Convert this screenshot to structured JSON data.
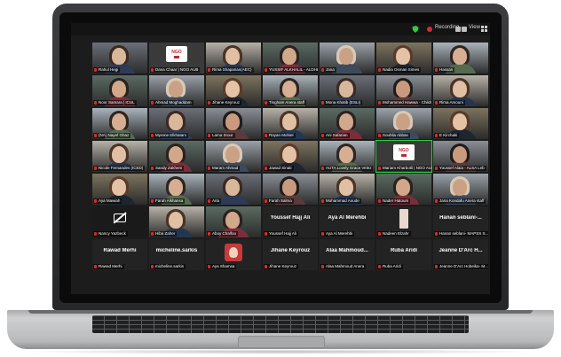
{
  "topbar": {
    "recording_label": "Recording...",
    "view_label": "View"
  },
  "rows": [
    [
      {
        "name": "Rahul Hegi"
      },
      {
        "name": "Dana Chaar | NGO AUB",
        "logo": true
      },
      {
        "name": "Rima Shaparian(AEC)"
      },
      {
        "name": "YUSSIF ALKHALIL - ALDHL"
      },
      {
        "name": "Jana"
      },
      {
        "name": "Nadia Osman Simes"
      },
      {
        "name": "Hassan"
      }
    ],
    [
      {
        "name": "Noor Samara | ICUL"
      },
      {
        "name": "Ahmad Moghaddam"
      },
      {
        "name": "Jihane Keyrouz"
      },
      {
        "name": "Tingham Anera staff"
      },
      {
        "name": "Mona Khatib (ESLI)"
      },
      {
        "name": "Mohammed Hawwa - Childs"
      },
      {
        "name": "Rima Amouni"
      }
    ],
    [
      {
        "name": "(NA) Nayef Ghaz"
      },
      {
        "name": "Myrene Elkhatani"
      },
      {
        "name": "Lama Srour"
      },
      {
        "name": "Rayan Mohiel"
      },
      {
        "name": "Ani Safarian"
      },
      {
        "name": "Souhila Abbas"
      },
      {
        "name": "E Kirchaki"
      }
    ],
    [
      {
        "name": "Nicole Fernandes (ICED)"
      },
      {
        "name": "Sandy Zakhem"
      },
      {
        "name": "Maram Ahmad"
      },
      {
        "name": "Jawad Sinati"
      },
      {
        "name": "AUTA Lovely Grace Velez"
      },
      {
        "name": "Mariam Kharbotli | NGO AUB",
        "logo": true,
        "active": true
      },
      {
        "name": "Youssef Alaia - ALSA Leb"
      }
    ],
    [
      {
        "name": "Aya Mawiah"
      },
      {
        "name": "Farah Alkhansa"
      },
      {
        "name": "Aria"
      },
      {
        "name": "Farah Salma"
      },
      {
        "name": "Mohammad Aoude"
      },
      {
        "name": "Nader Hatoum"
      },
      {
        "name": "Jana Kondafu Anera staff"
      }
    ],
    [
      {
        "name": "Nancy Yazbeck",
        "camoff": true
      },
      {
        "name": "Hiba Zaher"
      },
      {
        "name": "Aboy Chalfoo"
      },
      {
        "name": "Youssef Hajj Ali",
        "big": "Youssef Hajj Ali"
      },
      {
        "name": "Aya Al Merehbi",
        "big": "Aya Al Merehbi"
      },
      {
        "name": "Nadeen Elzahr",
        "small_avatar": true
      },
      {
        "name": "Hanan seblani- MAPSS S...",
        "big": "Hanan seblani-..."
      }
    ],
    [
      {
        "name": "Rawad Merhi",
        "big": "Rawad Merhi"
      },
      {
        "name": "micheline.sarkis",
        "big": "micheline.sarkis"
      },
      {
        "name": "Aya Shamsa",
        "red_avatar": true
      },
      {
        "name": "Jihane Keyrouz",
        "big": "Jihane Keyrouz"
      },
      {
        "name": "Alaa Mahmoud Anera",
        "big": "Alaa Mahmoud..."
      },
      {
        "name": "Ruba Aridi",
        "big": "Ruba Aridi"
      },
      {
        "name": "Jeanne D'Arc Hobeika- M...",
        "big": "Jeanne D'Arc H..."
      }
    ]
  ]
}
